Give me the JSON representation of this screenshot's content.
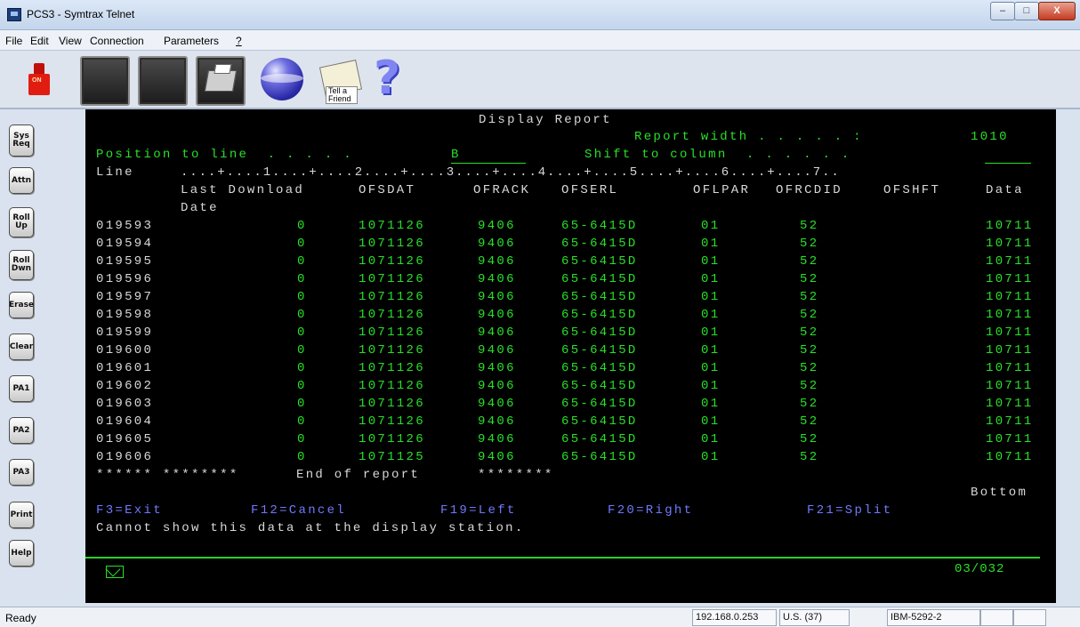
{
  "window": {
    "title": "PCS3 - Symtrax Telnet",
    "controls": {
      "minimize": "–",
      "maximize": "□",
      "close": "X"
    }
  },
  "menu": [
    "File",
    "Edit",
    "View",
    "Connection",
    "Parameters",
    "?"
  ],
  "toolbar": {
    "power_label": "ON",
    "tell_label": "Tell a Friend",
    "help_label": "?"
  },
  "function_keys": [
    "Sys\nReq",
    "Attn",
    "Roll\nUp",
    "Roll\nDwn",
    "Erase",
    "Clear",
    "PA1",
    "PA2",
    "PA3",
    "Print",
    "Help"
  ],
  "terminal": {
    "screen_title": "Display Report",
    "report_width_label": "Report width . . . . . :",
    "report_width_value": "1010",
    "position_label": "Position to line  . . . . .",
    "position_value": "B",
    "shift_label": "Shift to column  . . . . . .",
    "shift_value": "",
    "ruler_line_label": "Line",
    "ruler": "....+....1....+....2....+....3....+....4....+....5....+....6....+....7..",
    "headers": [
      "Last Download",
      "OFSDAT",
      "OFRACK",
      "OFSERL",
      "OFLPAR",
      "OFRCDID",
      "OFSHFT",
      "Data"
    ],
    "header_line2": "Date",
    "rows": [
      {
        "line": "019593",
        "last_download": "0",
        "ofsdat": "1071126",
        "ofrack": "9406",
        "ofserl": "65-6415D",
        "oflpar": "01",
        "ofrcdid": "52",
        "ofshft": "",
        "data": "10711"
      },
      {
        "line": "019594",
        "last_download": "0",
        "ofsdat": "1071126",
        "ofrack": "9406",
        "ofserl": "65-6415D",
        "oflpar": "01",
        "ofrcdid": "52",
        "ofshft": "",
        "data": "10711"
      },
      {
        "line": "019595",
        "last_download": "0",
        "ofsdat": "1071126",
        "ofrack": "9406",
        "ofserl": "65-6415D",
        "oflpar": "01",
        "ofrcdid": "52",
        "ofshft": "",
        "data": "10711"
      },
      {
        "line": "019596",
        "last_download": "0",
        "ofsdat": "1071126",
        "ofrack": "9406",
        "ofserl": "65-6415D",
        "oflpar": "01",
        "ofrcdid": "52",
        "ofshft": "",
        "data": "10711"
      },
      {
        "line": "019597",
        "last_download": "0",
        "ofsdat": "1071126",
        "ofrack": "9406",
        "ofserl": "65-6415D",
        "oflpar": "01",
        "ofrcdid": "52",
        "ofshft": "",
        "data": "10711"
      },
      {
        "line": "019598",
        "last_download": "0",
        "ofsdat": "1071126",
        "ofrack": "9406",
        "ofserl": "65-6415D",
        "oflpar": "01",
        "ofrcdid": "52",
        "ofshft": "",
        "data": "10711"
      },
      {
        "line": "019599",
        "last_download": "0",
        "ofsdat": "1071126",
        "ofrack": "9406",
        "ofserl": "65-6415D",
        "oflpar": "01",
        "ofrcdid": "52",
        "ofshft": "",
        "data": "10711"
      },
      {
        "line": "019600",
        "last_download": "0",
        "ofsdat": "1071126",
        "ofrack": "9406",
        "ofserl": "65-6415D",
        "oflpar": "01",
        "ofrcdid": "52",
        "ofshft": "",
        "data": "10711"
      },
      {
        "line": "019601",
        "last_download": "0",
        "ofsdat": "1071126",
        "ofrack": "9406",
        "ofserl": "65-6415D",
        "oflpar": "01",
        "ofrcdid": "52",
        "ofshft": "",
        "data": "10711"
      },
      {
        "line": "019602",
        "last_download": "0",
        "ofsdat": "1071126",
        "ofrack": "9406",
        "ofserl": "65-6415D",
        "oflpar": "01",
        "ofrcdid": "52",
        "ofshft": "",
        "data": "10711"
      },
      {
        "line": "019603",
        "last_download": "0",
        "ofsdat": "1071126",
        "ofrack": "9406",
        "ofserl": "65-6415D",
        "oflpar": "01",
        "ofrcdid": "52",
        "ofshft": "",
        "data": "10711"
      },
      {
        "line": "019604",
        "last_download": "0",
        "ofsdat": "1071126",
        "ofrack": "9406",
        "ofserl": "65-6415D",
        "oflpar": "01",
        "ofrcdid": "52",
        "ofshft": "",
        "data": "10711"
      },
      {
        "line": "019605",
        "last_download": "0",
        "ofsdat": "1071126",
        "ofrack": "9406",
        "ofserl": "65-6415D",
        "oflpar": "01",
        "ofrcdid": "52",
        "ofshft": "",
        "data": "10711"
      },
      {
        "line": "019606",
        "last_download": "0",
        "ofsdat": "1071125",
        "ofrack": "9406",
        "ofserl": "65-6415D",
        "oflpar": "01",
        "ofrcdid": "52",
        "ofshft": "",
        "data": "10711"
      }
    ],
    "end_left": "****** ********",
    "end_text": "End of report",
    "end_right": "********",
    "bottom": "Bottom",
    "fkeys": [
      "F3=Exit",
      "F12=Cancel",
      "F19=Left",
      "F20=Right",
      "F21=Split"
    ],
    "message": "Cannot show this data at the display station.",
    "cursor_position": "03/032"
  },
  "status": {
    "ready": "Ready",
    "ip": "192.168.0.253",
    "locale": "U.S. (37)",
    "device": "IBM-5292-2"
  },
  "colors": {
    "terminal_bg": "#000000",
    "terminal_green": "#28e028",
    "terminal_white": "#d8d8d8",
    "terminal_blue": "#6f79ff"
  }
}
